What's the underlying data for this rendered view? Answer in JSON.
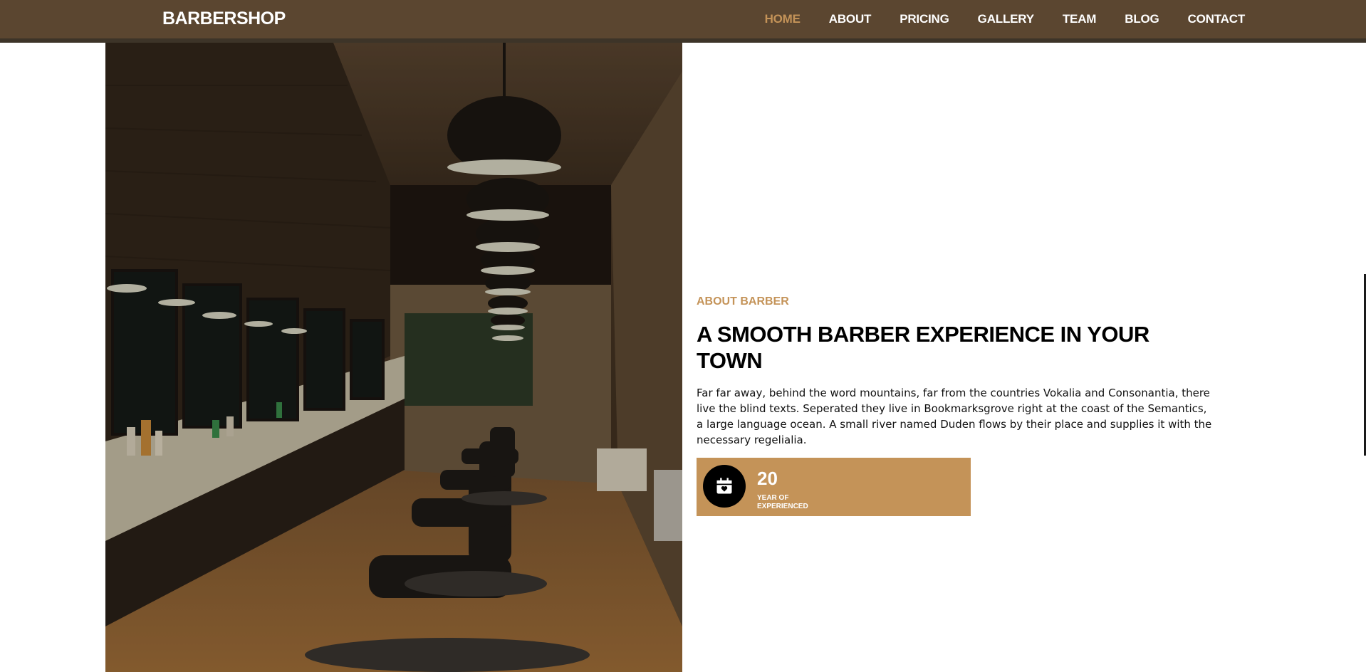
{
  "navbar": {
    "brand": "BARBERSHOP",
    "links": [
      {
        "label": "HOME",
        "active": true
      },
      {
        "label": "ABOUT"
      },
      {
        "label": "PRICING"
      },
      {
        "label": "GALLERY"
      },
      {
        "label": "TEAM"
      },
      {
        "label": "BLOG"
      },
      {
        "label": "CONTACT"
      }
    ]
  },
  "about": {
    "subheading": "ABOUT BARBER",
    "heading": "A SMOOTH BARBER EXPERIENCE IN YOUR TOWN",
    "description": "Far far away, behind the word mountains, far from the countries Vokalia and Consonantia, there live the blind texts. Seperated they live in Bookmarksgrove right at the coast of the Semantics, a large language ocean. A small river named Duden flows by their place and supplies it with the necessary regelialia.",
    "stat": {
      "number": "20",
      "label": "YEAR OF EXPERIENCED",
      "icon": "calendar-heart-icon"
    }
  },
  "colors": {
    "navbar_bg": "#5b4630",
    "accent": "#c49358",
    "heading": "#000000"
  },
  "image": {
    "subject": "barbershop-interior-photo"
  }
}
